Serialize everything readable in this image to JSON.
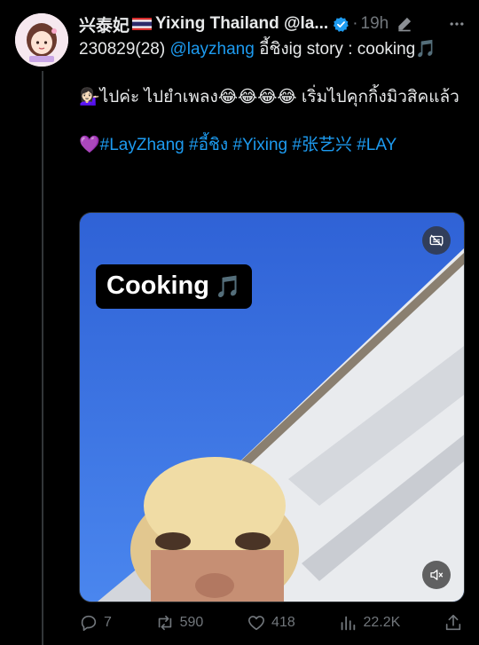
{
  "tweet": {
    "author_name": "兴泰妃",
    "display_name": "Yixing Thailand @la...",
    "separator": "·",
    "timestamp": "19h",
    "line1_prefix": "230829(28) ",
    "mention": "@layzhang",
    "line1_suffix": " อี้ชิงig story : cooking🎵",
    "line2": "💁🏻‍♀️ไปค่ะ ไปยำเพลง😂😂😂😂 เริ่มไปคุกกิ้งมิวสิคแล้ว",
    "hashtag_emoji": "💜",
    "hashtags": [
      "#LayZhang",
      "#อี้ชิง",
      "#Yixing",
      "#张艺兴",
      "#LAY"
    ]
  },
  "media": {
    "caption": "Cooking",
    "caption_note": "🎵"
  },
  "actions": {
    "replies": "7",
    "retweets": "590",
    "likes": "418",
    "views": "22.2K"
  },
  "colors": {
    "link": "#1d9bf0",
    "muted": "#71767b",
    "verified": "#1d9bf0",
    "sky": "#3a6fe0"
  }
}
